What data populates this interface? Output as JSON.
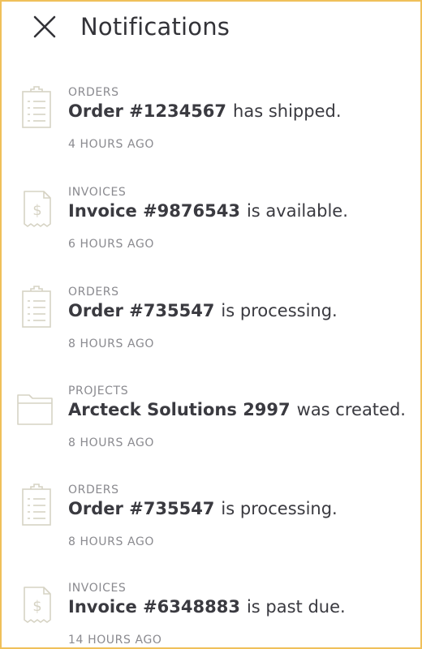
{
  "header": {
    "title": "Notifications",
    "close_icon": "close-icon"
  },
  "notifications": [
    {
      "icon": "clipboard-icon",
      "category": "ORDERS",
      "reference": "Order #1234567",
      "message": "has shipped.",
      "time": "4 HOURS AGO"
    },
    {
      "icon": "invoice-icon",
      "category": "INVOICES",
      "reference": "Invoice #9876543",
      "message": "is available.",
      "time": "6 HOURS AGO"
    },
    {
      "icon": "clipboard-icon",
      "category": "ORDERS",
      "reference": "Order #735547",
      "message": "is processing.",
      "time": "8 HOURS AGO"
    },
    {
      "icon": "folder-icon",
      "category": "PROJECTS",
      "reference": "Arcteck Solutions 2997",
      "message": "was created.",
      "time": "8 HOURS AGO"
    },
    {
      "icon": "clipboard-icon",
      "category": "ORDERS",
      "reference": "Order #735547",
      "message": "is processing.",
      "time": "8 HOURS AGO"
    },
    {
      "icon": "invoice-icon",
      "category": "INVOICES",
      "reference": "Invoice #6348883",
      "message": "is past due.",
      "time": "14 HOURS AGO"
    }
  ],
  "colors": {
    "frame_border": "#f0c05a",
    "icon_stroke": "#d6d3c4",
    "text_primary": "#3a3a40",
    "text_muted": "#8a8a8f"
  }
}
